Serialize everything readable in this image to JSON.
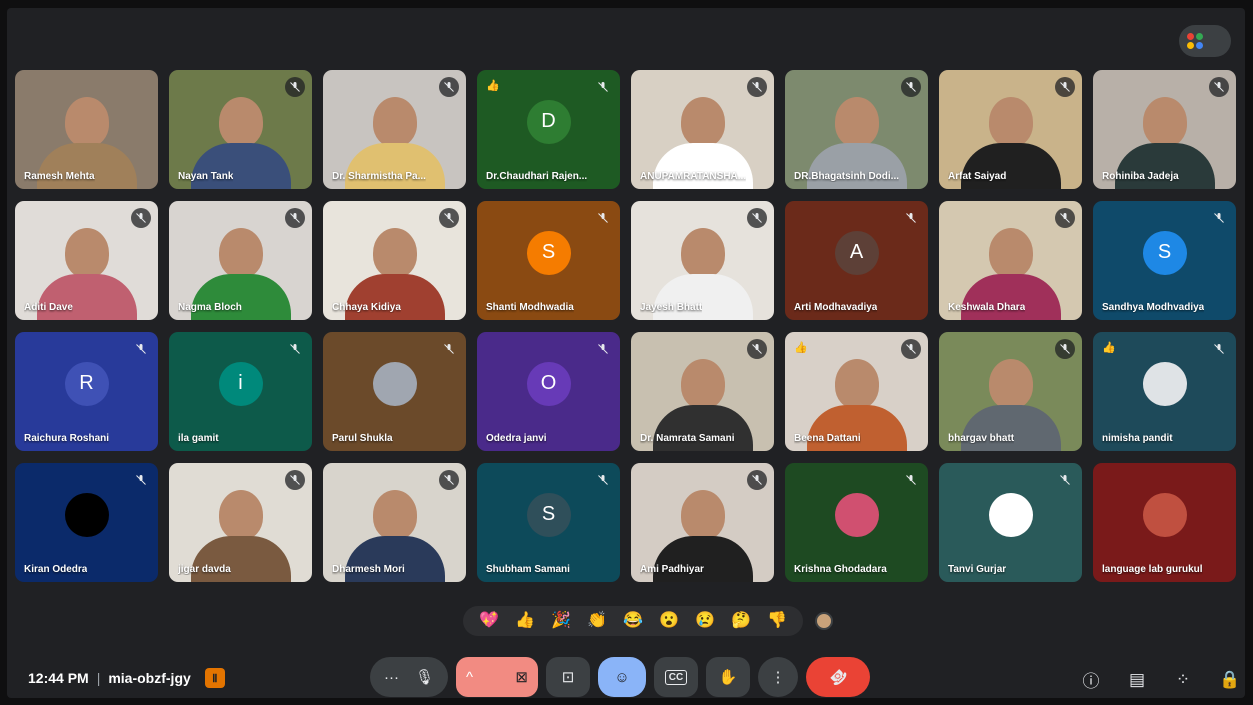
{
  "meeting": {
    "time": "12:44 PM",
    "separator": "|",
    "code": "mia-obzf-jgy"
  },
  "colors": {
    "background": "#202124",
    "leave": "#ea4335",
    "accent": "#8ab4f8",
    "recording": "#e37400"
  },
  "participants": [
    {
      "name": "Ramesh Mehta",
      "type": "video",
      "bg": "#8a7b6b",
      "shirt": "#a0805a",
      "muted": false
    },
    {
      "name": "Nayan Tank",
      "type": "video",
      "bg": "#6d7a4a",
      "shirt": "#3a4f7a",
      "muted": true
    },
    {
      "name": "Dr. Sharmistha Pa...",
      "type": "video",
      "bg": "#c8c4c0",
      "shirt": "#e0c070",
      "muted": true
    },
    {
      "name": "Dr.Chaudhari Rajen...",
      "type": "avatar",
      "initial": "D",
      "bg": "#1e5a23",
      "avatarColor": "#2e7d32",
      "muted": true,
      "thumb": "👍"
    },
    {
      "name": "ANUPAMRATANSHA...",
      "type": "video",
      "bg": "#d8d0c4",
      "shirt": "#ffffff",
      "muted": true
    },
    {
      "name": "DR.Bhagatsinh Dodi...",
      "type": "video",
      "bg": "#7d8a6e",
      "shirt": "#9aa0a6",
      "muted": true
    },
    {
      "name": "Arfat Saiyad",
      "type": "video",
      "bg": "#c9b38a",
      "shirt": "#202020",
      "muted": true
    },
    {
      "name": "Rohiniba Jadeja",
      "type": "video",
      "bg": "#b8b0a8",
      "shirt": "#2a3a3a",
      "muted": true
    },
    {
      "name": "Aditi Dave",
      "type": "video",
      "bg": "#e0dcd8",
      "shirt": "#c06070",
      "muted": true
    },
    {
      "name": "Nagma Bloch",
      "type": "video",
      "bg": "#d8d4d0",
      "shirt": "#2e8b3a",
      "muted": true
    },
    {
      "name": "Chhaya Kidiya",
      "type": "video",
      "bg": "#e8e4dc",
      "shirt": "#a04030",
      "muted": true
    },
    {
      "name": "Shanti Modhwadia",
      "type": "avatar",
      "initial": "S",
      "bg": "#8a4a12",
      "avatarColor": "#f57c00",
      "muted": true
    },
    {
      "name": "Jayesh Bhatt",
      "type": "video",
      "bg": "#e6e2dc",
      "shirt": "#f0f0f0",
      "muted": true
    },
    {
      "name": "Arti Modhavadiya",
      "type": "avatar",
      "initial": "A",
      "bg": "#6b2a1a",
      "avatarColor": "#5d4037",
      "muted": true
    },
    {
      "name": "Keshwala Dhara",
      "type": "video",
      "bg": "#d4c8b0",
      "shirt": "#a0305a",
      "muted": true
    },
    {
      "name": "Sandhya Modhvadiya",
      "type": "avatar",
      "initial": "S",
      "bg": "#0f4a6a",
      "avatarColor": "#1e88e5",
      "muted": true
    },
    {
      "name": "Raichura Roshani",
      "type": "avatar",
      "initial": "R",
      "bg": "#283a9a",
      "avatarColor": "#3f51b5",
      "muted": true
    },
    {
      "name": "ila gamit",
      "type": "avatar",
      "initial": "i",
      "bg": "#0d5a4a",
      "avatarColor": "#00897b",
      "muted": true
    },
    {
      "name": "Parul Shukla",
      "type": "avatar",
      "initial": "",
      "bg": "#6b4a2a",
      "avatarColor": "#a0a6b0",
      "muted": true
    },
    {
      "name": "Odedra janvi",
      "type": "avatar",
      "initial": "O",
      "bg": "#4a2a8a",
      "avatarColor": "#673ab7",
      "muted": true
    },
    {
      "name": "Dr. Namrata Samani",
      "type": "video",
      "bg": "#c8c0b0",
      "shirt": "#303030",
      "muted": true
    },
    {
      "name": "Beena Dattani",
      "type": "video",
      "bg": "#d8d0c8",
      "shirt": "#c06030",
      "muted": true,
      "thumb": "👍"
    },
    {
      "name": "bhargav bhatt",
      "type": "video",
      "bg": "#7a8a5a",
      "shirt": "#606870",
      "muted": true
    },
    {
      "name": "nimisha pandit",
      "type": "avatar",
      "initial": "",
      "bg": "#1e4a5a",
      "avatarColor": "#dfe3e6",
      "muted": true,
      "thumb": "👍"
    },
    {
      "name": "Kiran Odedra",
      "type": "avatar",
      "initial": "",
      "bg": "#0b2a6a",
      "avatarColor": "#000000",
      "muted": true
    },
    {
      "name": "jigar davda",
      "type": "video",
      "bg": "#e0dcd4",
      "shirt": "#7a5a40",
      "muted": true
    },
    {
      "name": "Dharmesh Mori",
      "type": "video",
      "bg": "#d8d4cc",
      "shirt": "#2a3a5a",
      "muted": true
    },
    {
      "name": "Shubham Samani",
      "type": "avatar",
      "initial": "S",
      "bg": "#0d4a5a",
      "avatarColor": "#2f4f5a",
      "muted": true
    },
    {
      "name": "Ami Padhiyar",
      "type": "video",
      "bg": "#d4ccc4",
      "shirt": "#202020",
      "muted": true
    },
    {
      "name": "Krishna Ghodadara",
      "type": "avatar",
      "initial": "",
      "bg": "#1e4a22",
      "avatarColor": "#d05070",
      "muted": true
    },
    {
      "name": "Tanvi Gurjar",
      "type": "avatar",
      "initial": "",
      "bg": "#2a5a5a",
      "avatarColor": "#ffffff",
      "muted": true
    },
    {
      "name": "language lab gurukul",
      "type": "avatar",
      "initial": "",
      "bg": "#7a1a1a",
      "avatarColor": "#c05040",
      "muted": false
    }
  ],
  "reactions": [
    "💖",
    "👍",
    "🎉",
    "👏",
    "😂",
    "😮",
    "😢",
    "🤔",
    "👎"
  ],
  "controls": {
    "more_emoji": "···",
    "mic_icon": "🎙",
    "caret": "^",
    "camera_icon": "⊠",
    "present_icon": "⊡",
    "emoji_icon": "☺",
    "captions_icon": "CC",
    "raise_hand_icon": "✋",
    "more_options_icon": "⋮",
    "leave_icon": "☎"
  },
  "right_icons": {
    "info": "ⓘ",
    "chat": "▤",
    "activities": "⁘",
    "host_controls": "🔒"
  },
  "recording_icon": "Ⅱ"
}
